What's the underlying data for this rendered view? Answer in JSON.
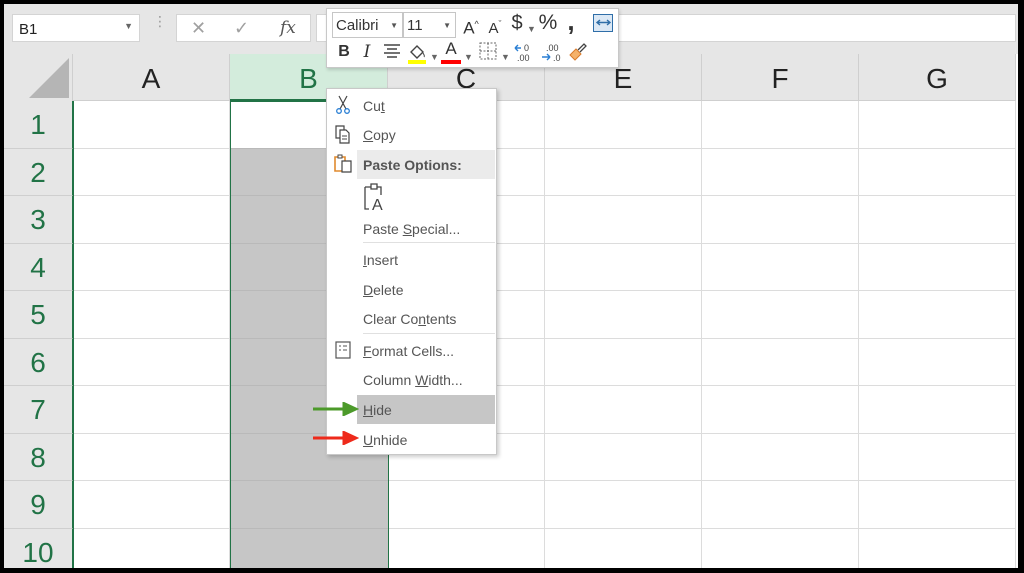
{
  "formula_bar": {
    "name_box": "B1",
    "cancel_icon": "x-icon",
    "enter_icon": "check-icon",
    "function_label": "fx",
    "formula_value": ""
  },
  "grid": {
    "columns": [
      "A",
      "B",
      "C",
      "E",
      "F",
      "G"
    ],
    "selected_column": "B",
    "rows": [
      "1",
      "2",
      "3",
      "4",
      "5",
      "6",
      "7",
      "8",
      "9",
      "10"
    ],
    "active_cell": "B1"
  },
  "mini_toolbar": {
    "font_name": "Calibri",
    "font_size": "11",
    "buttons": {
      "increase_font": "A",
      "decrease_font": "A",
      "currency": "$",
      "percent": "%",
      "comma": "❟",
      "bold": "B",
      "italic": "I",
      "font_color": "A"
    },
    "colors": {
      "fill": "#ffff00",
      "font": "#ff0000"
    }
  },
  "context_menu": {
    "items": [
      {
        "label": "Cut",
        "accel_index": 2,
        "icon": "scissors-icon"
      },
      {
        "label": "Copy",
        "accel_index": 0,
        "icon": "copy-icon"
      },
      {
        "label": "Paste Options:",
        "icon": "paste-icon"
      },
      {
        "label": "Paste Special...",
        "accel_index": 6
      },
      {
        "label": "Insert",
        "accel_index": 0
      },
      {
        "label": "Delete",
        "accel_index": 0
      },
      {
        "label": "Clear Contents",
        "accel_index": 8
      },
      {
        "label": "Format Cells...",
        "accel_index": 0,
        "icon": "format-cells-icon"
      },
      {
        "label": "Column Width...",
        "accel_index": 7
      },
      {
        "label": "Hide",
        "accel_index": 0,
        "highlighted": true
      },
      {
        "label": "Unhide",
        "accel_index": 0
      }
    ]
  },
  "annotations": {
    "hide_arrow_color": "#4c9a2a",
    "unhide_arrow_color": "#ee2a1b"
  }
}
